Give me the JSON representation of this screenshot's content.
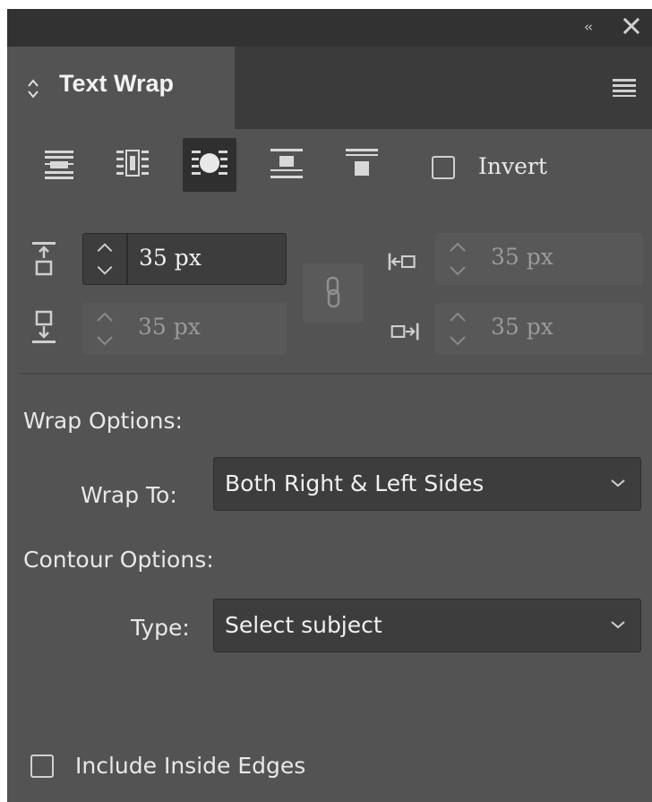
{
  "panel": {
    "title": "Text Wrap",
    "collapse_glyph": "‹‹",
    "icons": {
      "collapse": "double-chevron-left-icon",
      "close": "close-icon",
      "tab_arrows": "updown-arrows-icon",
      "menu": "hamburger-menu-icon"
    }
  },
  "wrap_modes": [
    {
      "name": "no-text-wrap",
      "selected": false
    },
    {
      "name": "wrap-around-bounding-box",
      "selected": false
    },
    {
      "name": "wrap-around-object-shape",
      "selected": true
    },
    {
      "name": "jump-object",
      "selected": false
    },
    {
      "name": "jump-to-next-column",
      "selected": false
    }
  ],
  "invert": {
    "label": "Invert",
    "checked": false
  },
  "offsets": {
    "top": "35 px",
    "bottom": "35 px",
    "left": "35 px",
    "right": "35 px",
    "linked": true
  },
  "wrap_options": {
    "heading": "Wrap Options:",
    "wrap_to_label": "Wrap To:",
    "wrap_to_value": "Both Right & Left Sides"
  },
  "contour_options": {
    "heading": "Contour Options:",
    "type_label": "Type:",
    "type_value": "Select subject"
  },
  "include_inside_edges": {
    "label": "Include Inside Edges",
    "checked": false
  },
  "colors": {
    "panel_bg": "#535353",
    "titlebar_bg": "#323232",
    "field_bg": "#3d3d3d",
    "text": "#e8e8e8",
    "disabled_text": "#9a9a9a"
  }
}
